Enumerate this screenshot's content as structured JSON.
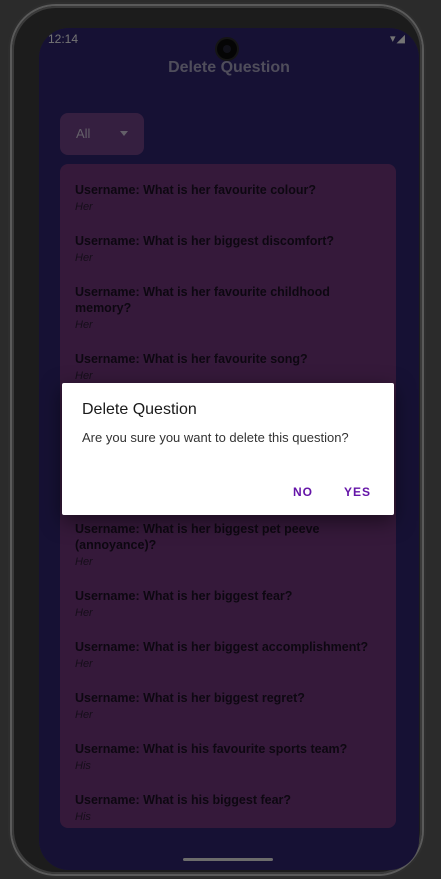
{
  "status": {
    "time": "12:14",
    "icons": "▾◢"
  },
  "app": {
    "title": "Delete Question"
  },
  "filter": {
    "selected": "All"
  },
  "questions": [
    {
      "title": "Username: What is her favourite colour?",
      "sub": "Her"
    },
    {
      "title": "Username: What is her biggest discomfort?",
      "sub": "Her"
    },
    {
      "title": "Username: What is her favourite childhood memory?",
      "sub": "Her"
    },
    {
      "title": "Username: What is her favourite song?",
      "sub": "Her"
    },
    {
      "title": "Username: What is her biggest pet peeve (annoyance)?",
      "sub": "Her"
    },
    {
      "title": "Username: What is her biggest fear?",
      "sub": "Her"
    },
    {
      "title": "Username: What is her biggest accomplishment?",
      "sub": "Her"
    },
    {
      "title": "Username: What is her biggest regret?",
      "sub": "Her"
    },
    {
      "title": "Username: What is his favourite sports team?",
      "sub": "His"
    },
    {
      "title": "Username: What is his biggest fear?",
      "sub": "His"
    }
  ],
  "dialog": {
    "title": "Delete Question",
    "message": "Are you sure you want to delete this question?",
    "no_label": "NO",
    "yes_label": "YES"
  },
  "colors": {
    "background": "#2d2268",
    "card": "#6a3374",
    "accent": "#6515a8"
  }
}
